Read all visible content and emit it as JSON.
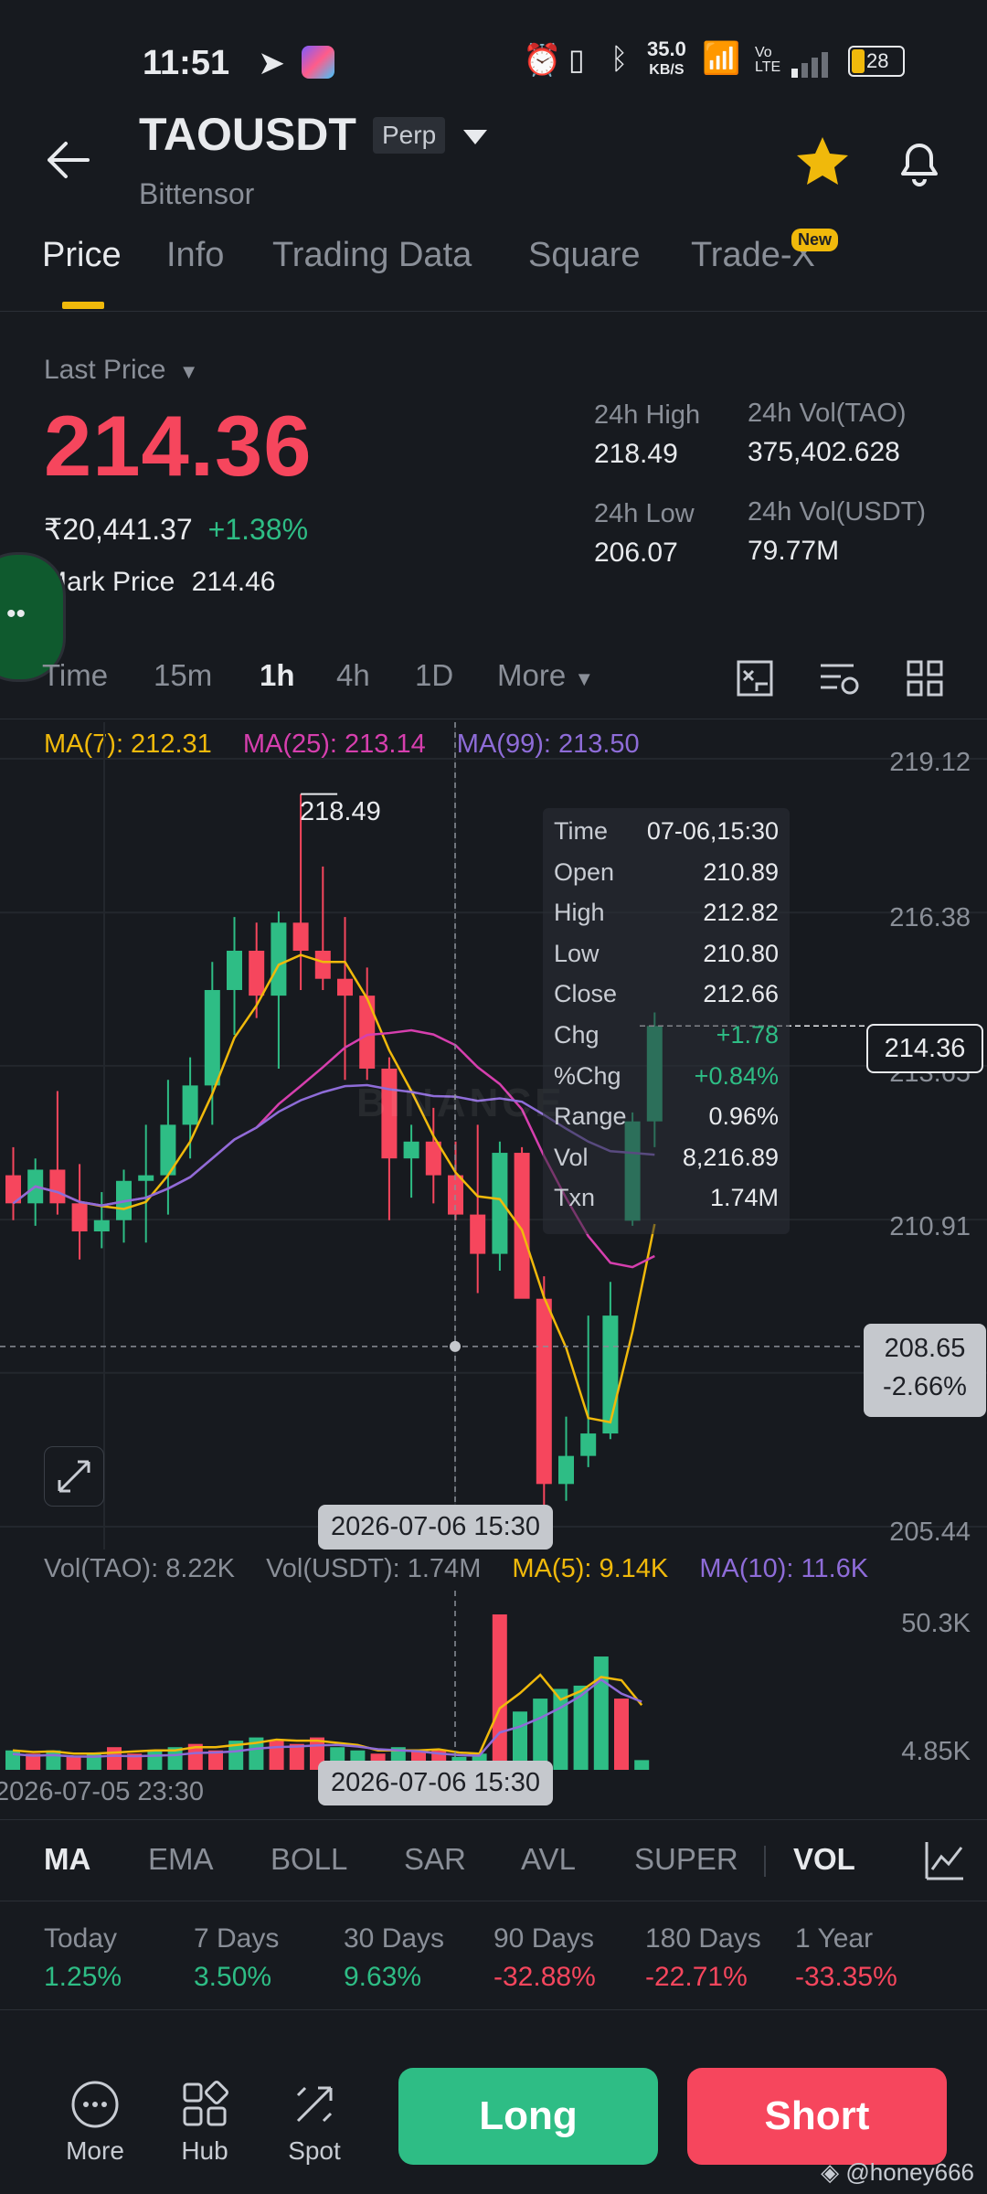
{
  "status_bar": {
    "time": "11:51",
    "net_speed": "35.0",
    "net_unit": "KB/S",
    "battery": "28"
  },
  "header": {
    "symbol": "TAOUSDT",
    "contract_type": "Perp",
    "name": "Bittensor"
  },
  "tabs": [
    {
      "label": "Price",
      "active": true
    },
    {
      "label": "Info"
    },
    {
      "label": "Trading Data"
    },
    {
      "label": "Square"
    },
    {
      "label": "Trade-X",
      "badge": "New"
    }
  ],
  "price": {
    "label": "Last Price",
    "last": "214.36",
    "inr": "₹20,441.37",
    "change": "+1.38%",
    "mark_label": "Mark Price",
    "mark_value": "214.46"
  },
  "stats": {
    "high_label": "24h High",
    "high": "218.49",
    "low_label": "24h Low",
    "low": "206.07",
    "vol_tao_label": "24h Vol(TAO)",
    "vol_tao": "375,402.628",
    "vol_usdt_label": "24h Vol(USDT)",
    "vol_usdt": "79.77M"
  },
  "intervals": [
    {
      "label": "Time"
    },
    {
      "label": "15m"
    },
    {
      "label": "1h",
      "active": true
    },
    {
      "label": "4h"
    },
    {
      "label": "1D"
    },
    {
      "label": "More"
    }
  ],
  "ma": {
    "ma7": "MA(7): 212.31",
    "ma25": "MA(25): 213.14",
    "ma99": "MA(99): 213.50"
  },
  "y_axis": [
    "219.12",
    "216.38",
    "213.65",
    "210.91",
    "205.44"
  ],
  "chart_labels": {
    "high_marker": "218.49",
    "last_tag": "214.36",
    "cross_price": "208.65",
    "cross_pct": "-2.66%",
    "cross_date": "2026-07-06 15:30",
    "watermark": "BINANCE"
  },
  "tooltip": [
    {
      "k": "Time",
      "v": "07-06,15:30"
    },
    {
      "k": "Open",
      "v": "210.89"
    },
    {
      "k": "High",
      "v": "212.82"
    },
    {
      "k": "Low",
      "v": "210.80"
    },
    {
      "k": "Close",
      "v": "212.66"
    },
    {
      "k": "Chg",
      "v": "+1.78",
      "color": "green"
    },
    {
      "k": "%Chg",
      "v": "+0.84%",
      "color": "green"
    },
    {
      "k": "Range",
      "v": "0.96%"
    },
    {
      "k": "Vol",
      "v": "8,216.89"
    },
    {
      "k": "Txn",
      "v": "1.74M"
    }
  ],
  "volume": {
    "vol_tao": "Vol(TAO): 8.22K",
    "vol_usdt": "Vol(USDT): 1.74M",
    "ma5": "MA(5): 9.14K",
    "ma10": "MA(10): 11.6K",
    "axis_top": "50.3K",
    "axis_bottom": "4.85K",
    "x_left": "2026-07-05 23:30",
    "x_cross": "2026-07-06 15:30"
  },
  "indicators": [
    {
      "label": "MA",
      "active": true
    },
    {
      "label": "EMA"
    },
    {
      "label": "BOLL"
    },
    {
      "label": "SAR"
    },
    {
      "label": "AVL"
    },
    {
      "label": "SUPER"
    },
    {
      "label": "VOL",
      "active": true
    }
  ],
  "returns": [
    {
      "label": "Today",
      "value": "1.25%",
      "color": "green"
    },
    {
      "label": "7 Days",
      "value": "3.50%",
      "color": "green"
    },
    {
      "label": "30 Days",
      "value": "9.63%",
      "color": "green"
    },
    {
      "label": "90 Days",
      "value": "-32.88%",
      "color": "red"
    },
    {
      "label": "180 Days",
      "value": "-22.71%",
      "color": "red"
    },
    {
      "label": "1 Year",
      "value": "-33.35%",
      "color": "red"
    }
  ],
  "bottom_nav": [
    {
      "label": "More"
    },
    {
      "label": "Hub"
    },
    {
      "label": "Spot"
    }
  ],
  "actions": {
    "long": "Long",
    "short": "Short"
  },
  "credit": "@honey666",
  "colors": {
    "up": "#2ebd85",
    "down": "#f6465d",
    "accent": "#f0b90b",
    "ma7": "#f0b90b",
    "ma25": "#d63fae",
    "ma99": "#8e6cd8"
  },
  "chart_data": {
    "type": "candlestick",
    "interval": "1h",
    "y_range": [
      205.44,
      219.12
    ],
    "candles": [
      {
        "o": 211.7,
        "h": 212.2,
        "l": 210.9,
        "c": 211.2
      },
      {
        "o": 211.2,
        "h": 212.0,
        "l": 210.8,
        "c": 211.8
      },
      {
        "o": 211.8,
        "h": 213.2,
        "l": 211.0,
        "c": 211.2
      },
      {
        "o": 211.2,
        "h": 211.9,
        "l": 210.2,
        "c": 210.7
      },
      {
        "o": 210.7,
        "h": 211.4,
        "l": 210.4,
        "c": 210.9
      },
      {
        "o": 210.9,
        "h": 211.8,
        "l": 210.5,
        "c": 211.6
      },
      {
        "o": 211.6,
        "h": 212.6,
        "l": 210.5,
        "c": 211.7
      },
      {
        "o": 211.7,
        "h": 213.4,
        "l": 211.0,
        "c": 212.6
      },
      {
        "o": 212.6,
        "h": 213.8,
        "l": 212.0,
        "c": 213.3
      },
      {
        "o": 213.3,
        "h": 215.5,
        "l": 212.6,
        "c": 215.0
      },
      {
        "o": 215.0,
        "h": 216.3,
        "l": 214.2,
        "c": 215.7
      },
      {
        "o": 215.7,
        "h": 216.2,
        "l": 214.5,
        "c": 214.9
      },
      {
        "o": 214.9,
        "h": 216.4,
        "l": 213.6,
        "c": 216.2
      },
      {
        "o": 216.2,
        "h": 218.49,
        "l": 215.0,
        "c": 215.7
      },
      {
        "o": 215.7,
        "h": 217.2,
        "l": 215.0,
        "c": 215.2
      },
      {
        "o": 215.2,
        "h": 216.3,
        "l": 213.4,
        "c": 214.9
      },
      {
        "o": 214.9,
        "h": 215.4,
        "l": 213.4,
        "c": 213.6
      },
      {
        "o": 213.6,
        "h": 213.8,
        "l": 210.9,
        "c": 212.0
      },
      {
        "o": 212.0,
        "h": 212.6,
        "l": 211.3,
        "c": 212.3
      },
      {
        "o": 212.3,
        "h": 212.9,
        "l": 211.2,
        "c": 211.7
      },
      {
        "o": 211.7,
        "h": 212.3,
        "l": 210.9,
        "c": 211.0
      },
      {
        "o": 211.0,
        "h": 212.6,
        "l": 209.6,
        "c": 210.3
      },
      {
        "o": 210.3,
        "h": 212.3,
        "l": 210.0,
        "c": 212.1
      },
      {
        "o": 212.1,
        "h": 212.2,
        "l": 209.9,
        "c": 209.5
      },
      {
        "o": 209.5,
        "h": 209.9,
        "l": 205.4,
        "c": 206.2
      },
      {
        "o": 206.2,
        "h": 207.4,
        "l": 205.9,
        "c": 206.7
      },
      {
        "o": 206.7,
        "h": 209.2,
        "l": 206.5,
        "c": 207.1
      },
      {
        "o": 207.1,
        "h": 209.8,
        "l": 207.0,
        "c": 209.2
      },
      {
        "o": 210.89,
        "h": 212.82,
        "l": 210.8,
        "c": 212.66
      },
      {
        "o": 212.66,
        "h": 214.6,
        "l": 212.2,
        "c": 214.36
      }
    ],
    "volumes": [
      6,
      5,
      6,
      4,
      5,
      7,
      5,
      6,
      7,
      8,
      6,
      9,
      10,
      9,
      8,
      10,
      7,
      6,
      5,
      7,
      6,
      6,
      4,
      5,
      48,
      18,
      22,
      25,
      26,
      35,
      22,
      3
    ]
  }
}
